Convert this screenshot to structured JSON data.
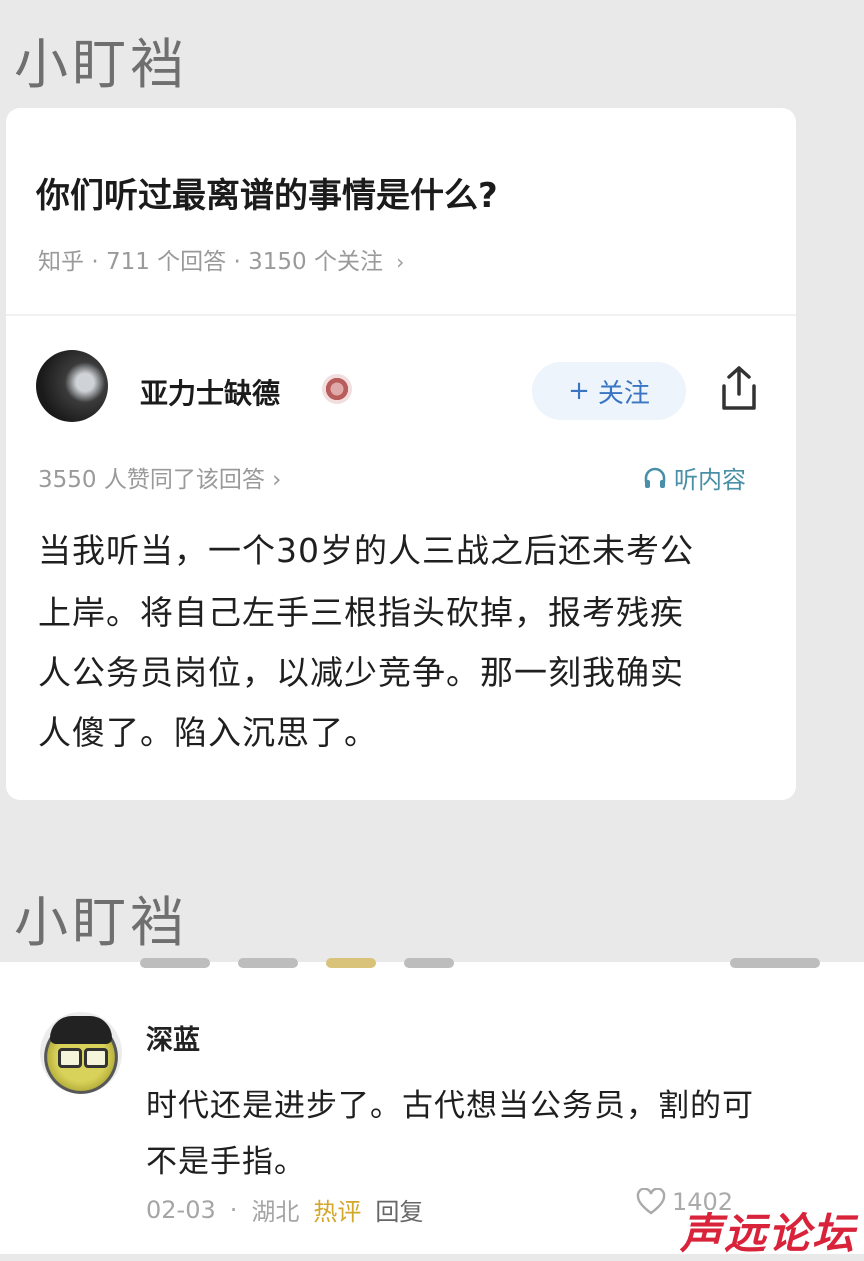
{
  "source_label": "小盯裆",
  "question": {
    "title": "你们听过最离谱的事情是什么?",
    "platform": "知乎",
    "answers": "711 个回答",
    "followers": "3150 个关注"
  },
  "answer": {
    "author": "亚力士缺德",
    "follow_label": "关注",
    "agree_text": "3550 人赞同了该回答",
    "listen_label": "听内容",
    "lines": [
      "当我听当，一个30岁的人三战之后还未考公",
      "上岸。将自己左手三根指头砍掉，报考残疾",
      "人公务员岗位，以减少竞争。那一刻我确实",
      "人傻了。陷入沉思了。"
    ]
  },
  "comment": {
    "author": "深蓝",
    "lines": [
      "时代还是进步了。古代想当公务员，割的可",
      "不是手指。"
    ],
    "date": "02-03",
    "location": "湖北",
    "hot_tag": "热评",
    "reply_label": "回复",
    "likes": "1402"
  },
  "watermark": "声远论坛",
  "colors": {
    "accent_blue": "#3a75c4",
    "hot_tag": "#d4a72c",
    "watermark": "#d8233a"
  },
  "icons": [
    "share-icon",
    "headphones-icon",
    "like-icon",
    "plus-icon",
    "chevron-right-icon"
  ]
}
